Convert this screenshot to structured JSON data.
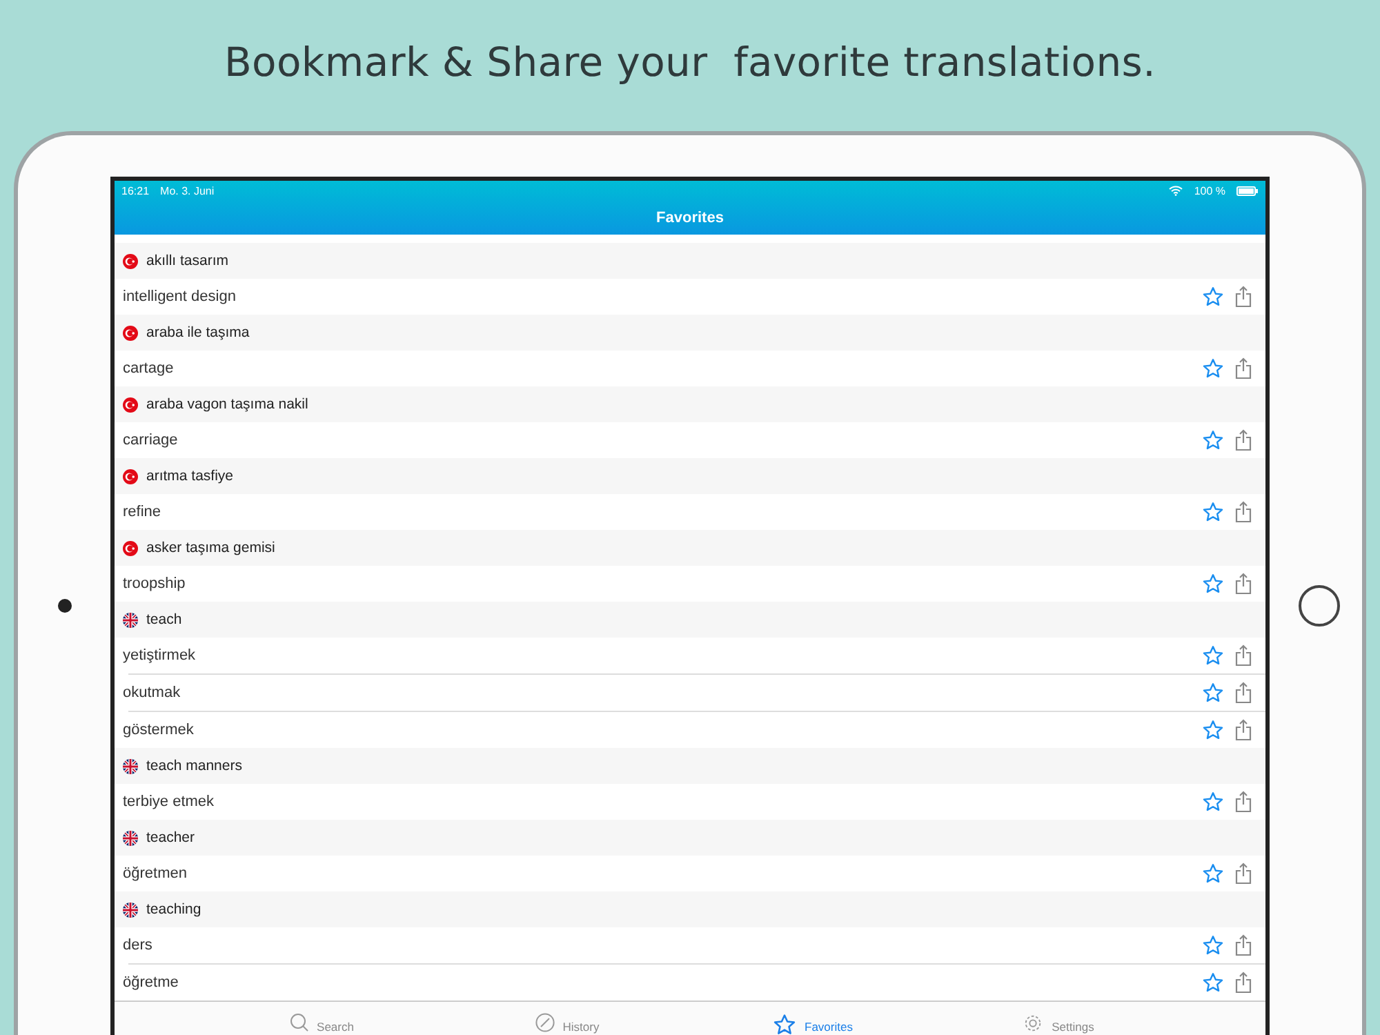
{
  "headline": "Bookmark & Share your  favorite translations.",
  "status_bar": {
    "time": "16:21",
    "date": "Mo. 3. Juni",
    "battery": "100 %"
  },
  "nav_title": "Favorites",
  "entries": [
    {
      "kind": "tr",
      "term": "akıllı tasarım",
      "translations": [
        "intelligent design"
      ]
    },
    {
      "kind": "tr",
      "term": "araba ile taşıma",
      "translations": [
        "cartage"
      ]
    },
    {
      "kind": "tr",
      "term": "araba vagon taşıma nakil",
      "translations": [
        "carriage"
      ]
    },
    {
      "kind": "tr",
      "term": "arıtma tasfiye",
      "translations": [
        "refine"
      ]
    },
    {
      "kind": "tr",
      "term": "asker taşıma gemisi",
      "translations": [
        "troopship"
      ]
    },
    {
      "kind": "gb",
      "term": "teach",
      "translations": [
        "yetiştirmek",
        "okutmak",
        "göstermek"
      ]
    },
    {
      "kind": "gb",
      "term": "teach manners",
      "translations": [
        "terbiye etmek"
      ]
    },
    {
      "kind": "gb",
      "term": "teacher",
      "translations": [
        "öğretmen"
      ]
    },
    {
      "kind": "gb",
      "term": "teaching",
      "translations": [
        "ders",
        "öğretme"
      ]
    }
  ],
  "tabs": [
    {
      "kind": "search",
      "label": "Search",
      "selected": false
    },
    {
      "kind": "history",
      "label": "History",
      "selected": false
    },
    {
      "kind": "favorites",
      "label": "Favorites",
      "selected": true
    },
    {
      "kind": "settings",
      "label": "Settings",
      "selected": false
    }
  ]
}
